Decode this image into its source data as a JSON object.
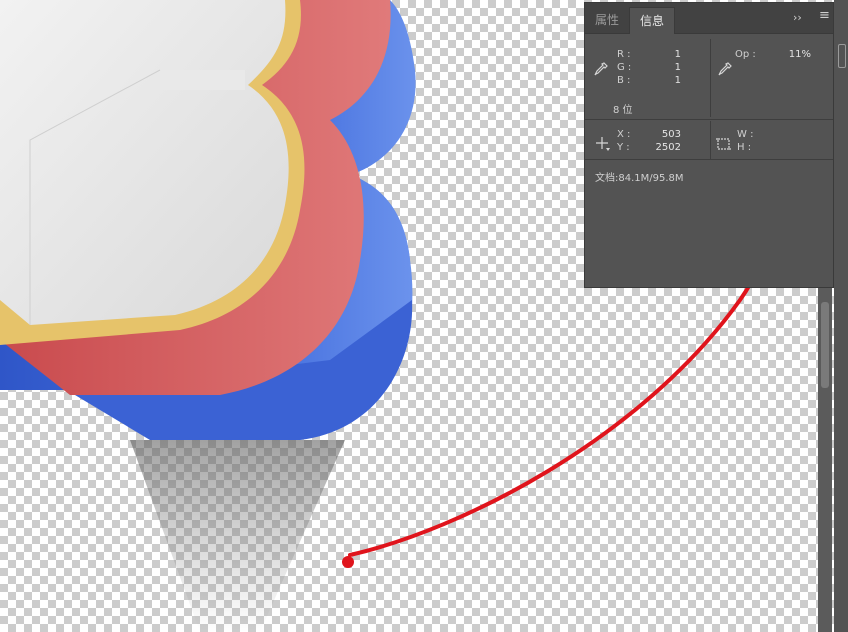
{
  "panel": {
    "tabs": [
      {
        "label": "属性",
        "active": false
      },
      {
        "label": "信息",
        "active": true
      }
    ],
    "expand_glyph": "››",
    "menu_glyph": "≡",
    "color": {
      "r_label": "R :",
      "r_value": "1",
      "g_label": "G :",
      "g_value": "1",
      "b_label": "B :",
      "b_value": "1",
      "bit_depth": "8 位"
    },
    "opacity": {
      "label": "Op :",
      "value": "11%"
    },
    "position": {
      "x_label": "X :",
      "x_value": "503",
      "y_label": "Y :",
      "y_value": "2502"
    },
    "size": {
      "w_label": "W :",
      "h_label": "H :"
    },
    "doc_info": "文档:84.1M/95.8M"
  },
  "colors": {
    "panel_bg": "#535353",
    "annotation_red": "#e0141c",
    "letter_red": "#d95c5e",
    "letter_blue": "#3f67d6",
    "letter_gold": "#e6c36a"
  },
  "icons": [
    "eyedropper-icon",
    "eyedropper-sampler-icon",
    "crosshair-icon",
    "selection-size-icon",
    "expand-panel-icon",
    "panel-menu-icon"
  ]
}
